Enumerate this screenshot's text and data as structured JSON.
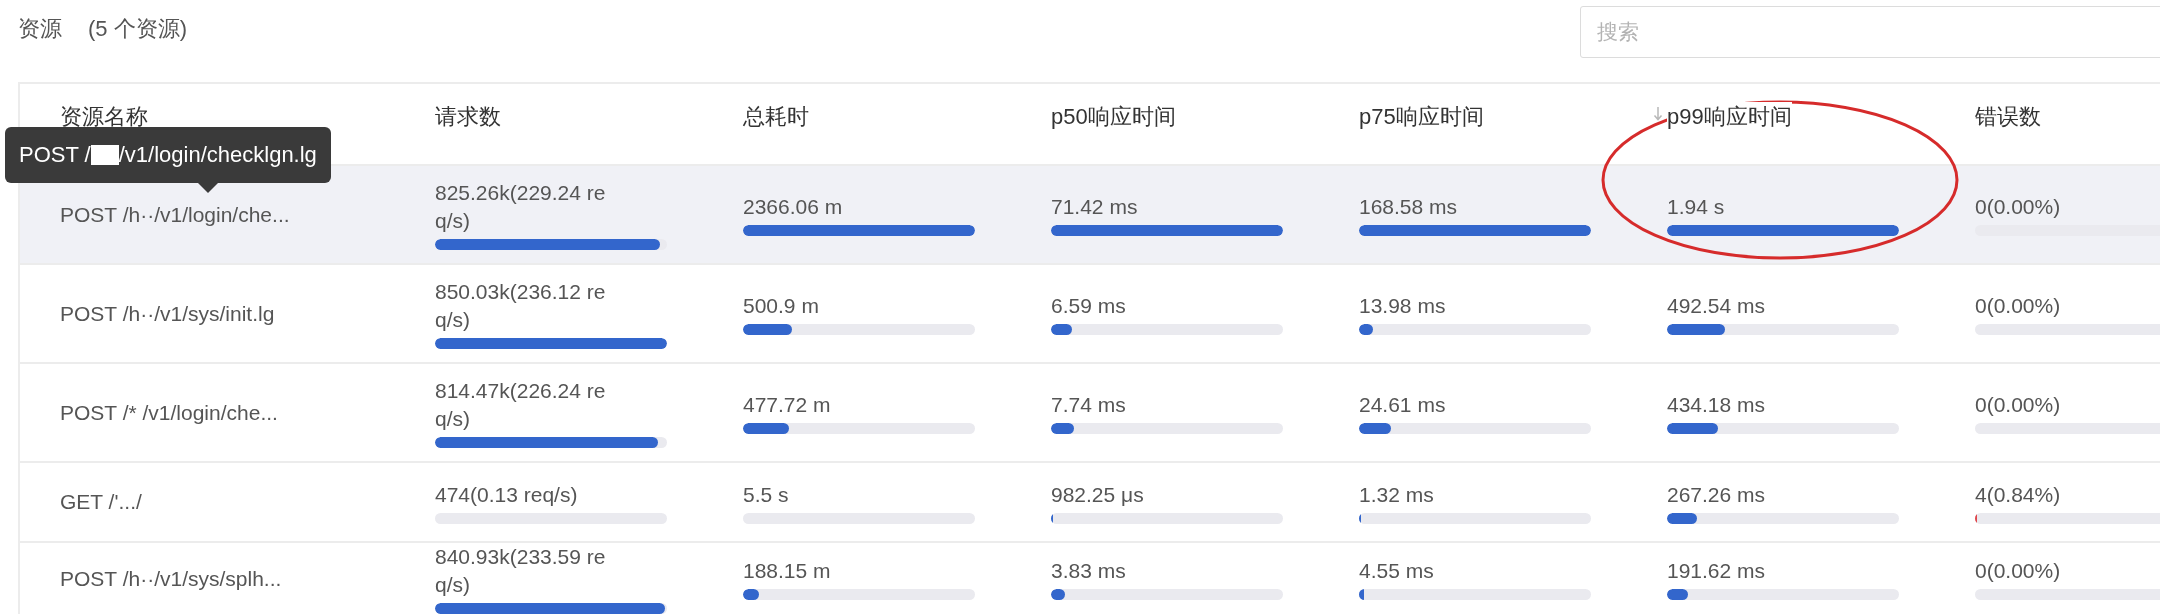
{
  "header": {
    "title": "资源",
    "count": "(5 个资源)"
  },
  "search": {
    "placeholder": "搜索"
  },
  "table": {
    "columns": [
      {
        "label": "资源名称",
        "sorted": false
      },
      {
        "label": "请求数",
        "sorted": false
      },
      {
        "label": "总耗时",
        "sorted": false
      },
      {
        "label": "p50响应时间",
        "sorted": false
      },
      {
        "label": "p75响应时间",
        "sorted": false
      },
      {
        "label": "p99响应时间",
        "sorted": true
      },
      {
        "label": "错误数",
        "sorted": false
      }
    ],
    "rows": [
      {
        "hovered": true,
        "cells": [
          {
            "text": "POST /h··/v1/login/che..."
          },
          {
            "text": "825.26k(229.24 req/s)",
            "level": 0.97
          },
          {
            "text": "2366.06 m",
            "level": 1
          },
          {
            "text": "71.42 ms",
            "level": 1
          },
          {
            "text": "168.58 ms",
            "level": 1
          },
          {
            "text": "1.94 s",
            "level": 1
          },
          {
            "text": "0(0.00%)",
            "level": 0
          }
        ]
      },
      {
        "hovered": false,
        "cells": [
          {
            "text": "POST /h··/v1/sys/init.lg"
          },
          {
            "text": "850.03k(236.12 req/s)",
            "level": 1
          },
          {
            "text": "500.9 m",
            "level": 0.21
          },
          {
            "text": "6.59 ms",
            "level": 0.09
          },
          {
            "text": "13.98 ms",
            "level": 0.06
          },
          {
            "text": "492.54 ms",
            "level": 0.25
          },
          {
            "text": "0(0.00%)",
            "level": 0
          }
        ]
      },
      {
        "hovered": false,
        "cells": [
          {
            "text": "POST /*  /v1/login/che..."
          },
          {
            "text": "814.47k(226.24 req/s)",
            "level": 0.96
          },
          {
            "text": "477.72 m",
            "level": 0.2
          },
          {
            "text": "7.74 ms",
            "level": 0.1
          },
          {
            "text": "24.61 ms",
            "level": 0.14
          },
          {
            "text": "434.18 ms",
            "level": 0.22
          },
          {
            "text": "0(0.00%)",
            "level": 0
          }
        ]
      },
      {
        "hovered": false,
        "cells": [
          {
            "text": "GET /'.../"
          },
          {
            "text": "474(0.13 req/s)",
            "level": 0
          },
          {
            "text": "5.5 s",
            "level": 0
          },
          {
            "text": "982.25 μs",
            "level": 0.01
          },
          {
            "text": "1.32 ms",
            "level": 0.01
          },
          {
            "text": "267.26 ms",
            "level": 0.13
          },
          {
            "text": "4(0.84%)",
            "level": 0.01,
            "color": "#e0474c"
          }
        ]
      },
      {
        "hovered": false,
        "cells": [
          {
            "text": "POST /h··/v1/sys/splh..."
          },
          {
            "text": "840.93k(233.59 req/s)",
            "level": 0.99
          },
          {
            "text": "188.15 m",
            "level": 0.07
          },
          {
            "text": "3.83 ms",
            "level": 0.06
          },
          {
            "text": "4.55 ms",
            "level": 0.02
          },
          {
            "text": "191.62 ms",
            "level": 0.09
          },
          {
            "text": "0(0.00%)",
            "level": 0
          }
        ]
      }
    ]
  },
  "tooltip": {
    "text_before": "POST /",
    "text_after": "/v1/login/checklgn.lg"
  }
}
